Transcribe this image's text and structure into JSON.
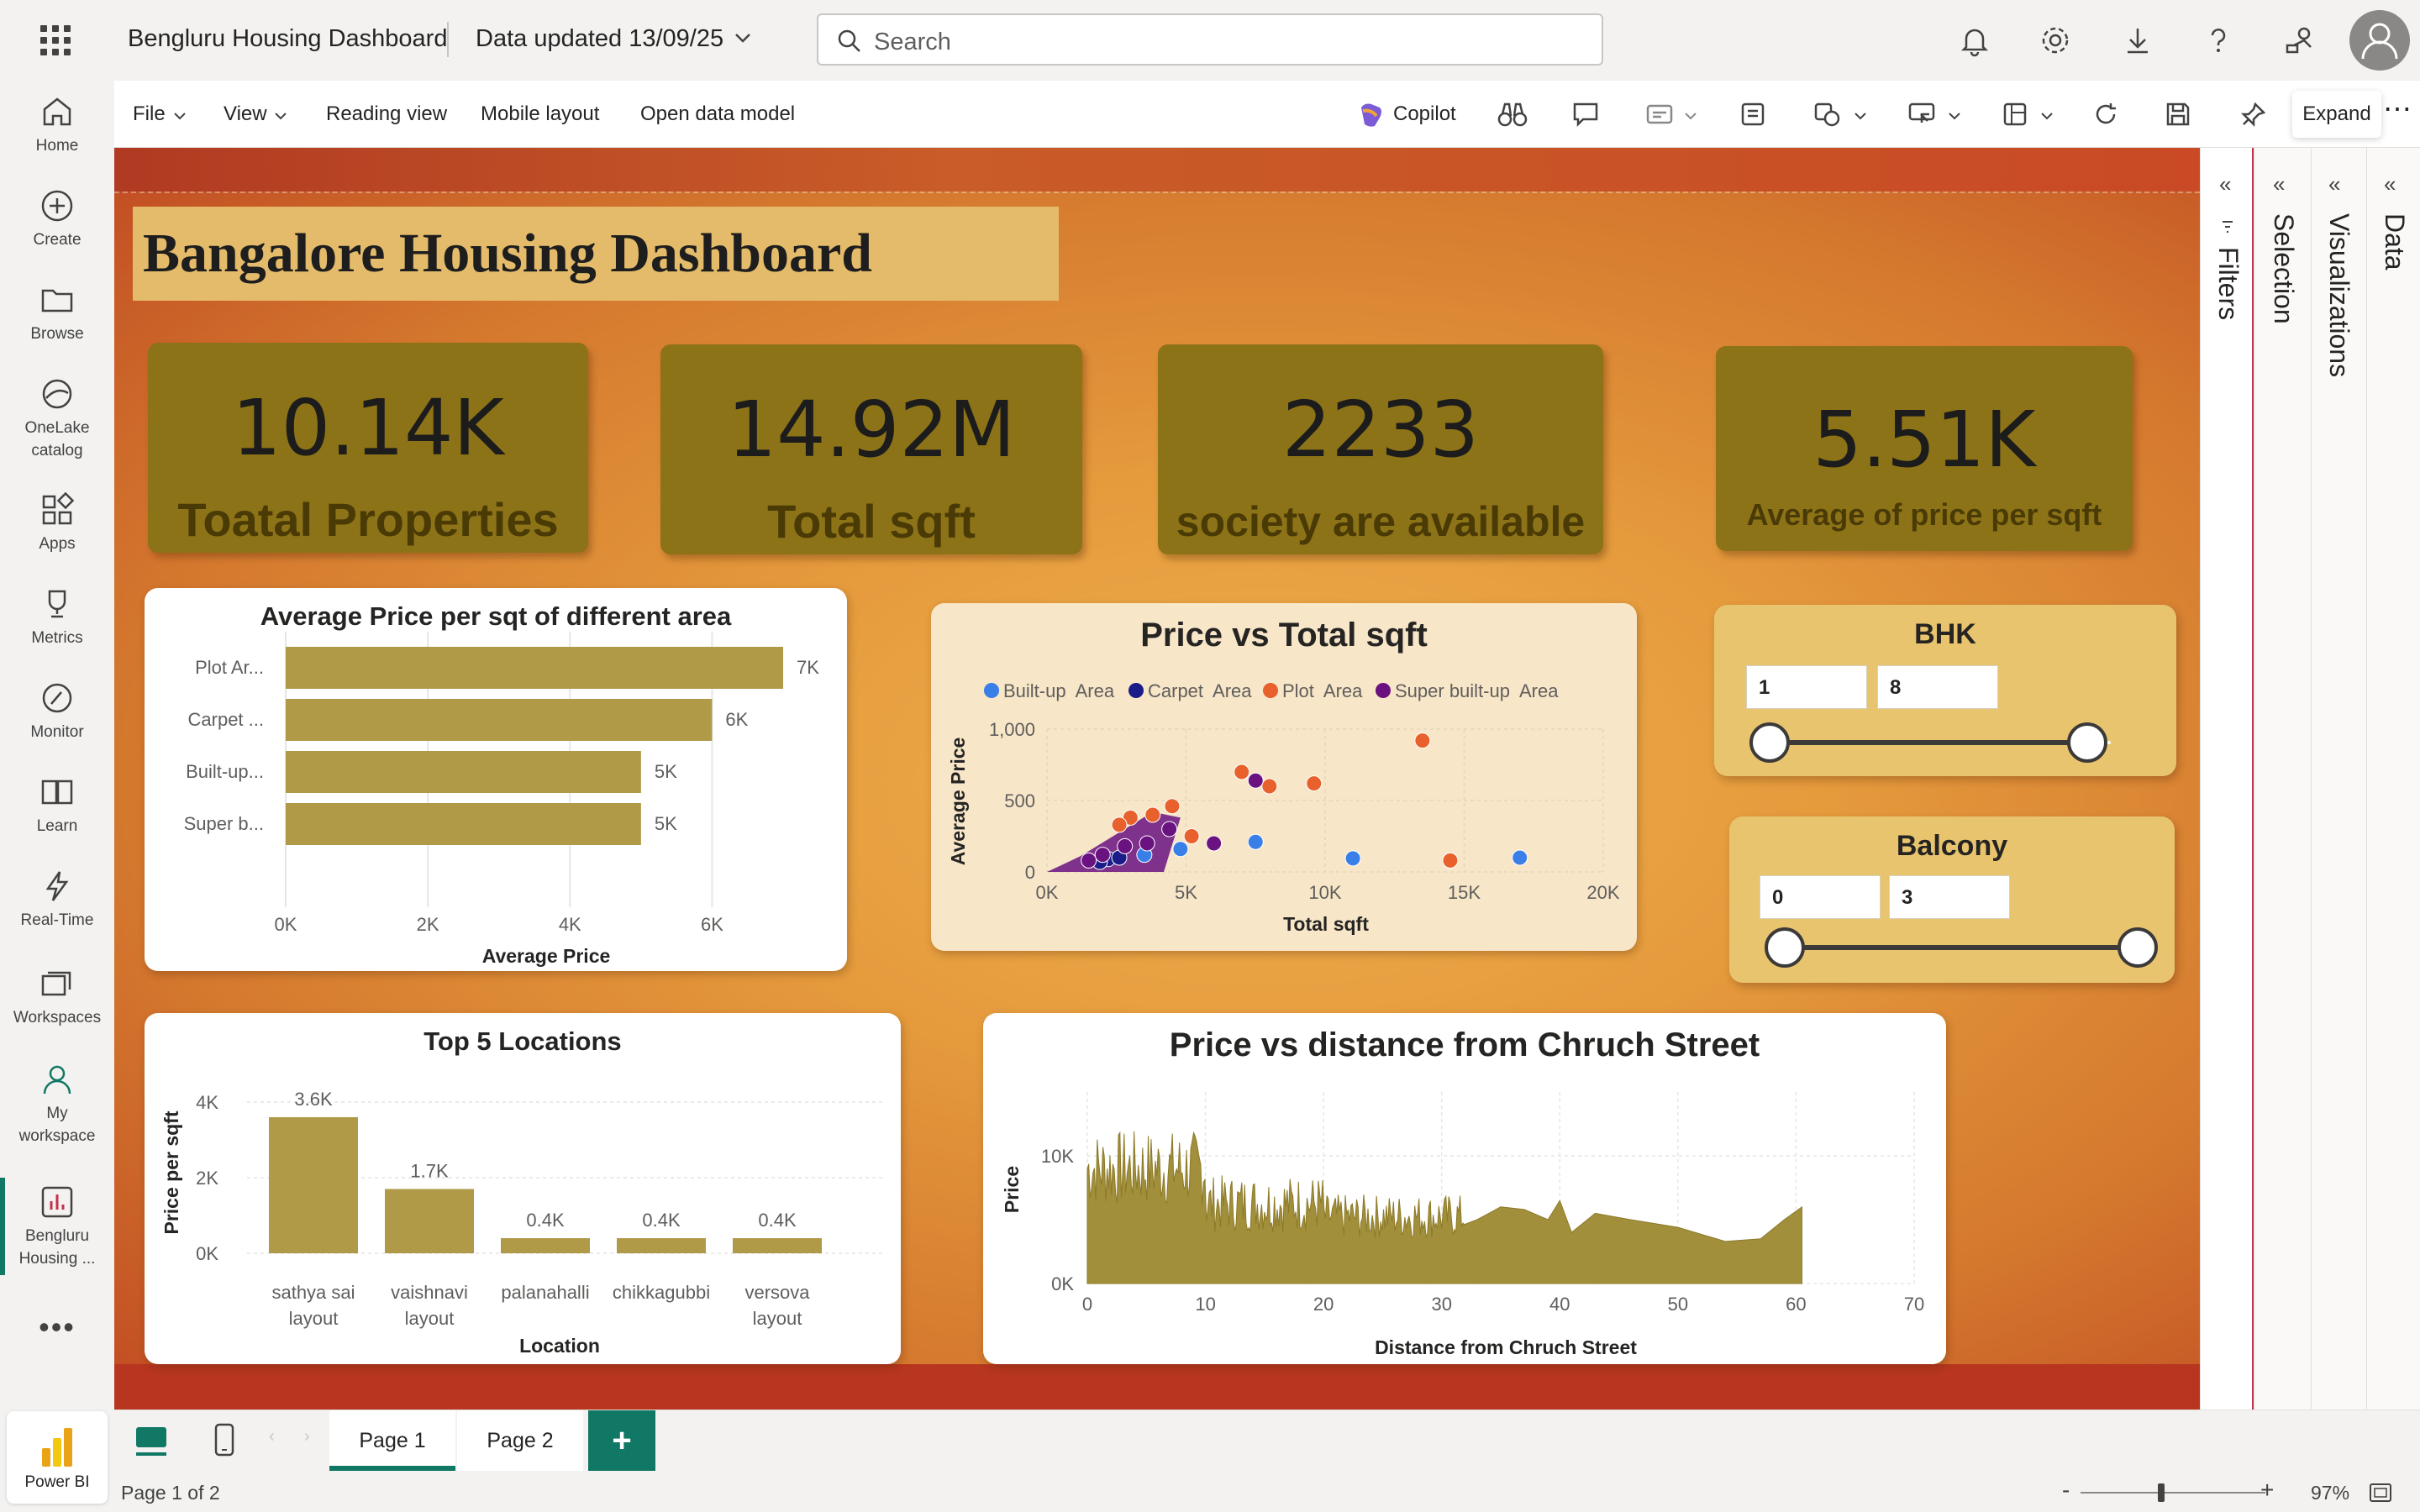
{
  "header": {
    "app_title": "Bengluru Housing Dashboard",
    "updated": "Data updated 13/09/25",
    "search_placeholder": "Search"
  },
  "rail": [
    {
      "label": "Home",
      "icon": "home-icon"
    },
    {
      "label": "Create",
      "icon": "plus-circle-icon"
    },
    {
      "label": "Browse",
      "icon": "folder-icon"
    },
    {
      "label": "OneLake catalog",
      "icon": "onelake-icon"
    },
    {
      "label": "Apps",
      "icon": "apps-icon"
    },
    {
      "label": "Metrics",
      "icon": "trophy-icon"
    },
    {
      "label": "Monitor",
      "icon": "monitor-icon"
    },
    {
      "label": "Learn",
      "icon": "book-icon"
    },
    {
      "label": "Real-Time",
      "icon": "lightning-icon"
    },
    {
      "label": "Workspaces",
      "icon": "workspaces-icon"
    },
    {
      "label": "My workspace",
      "icon": "person-icon"
    },
    {
      "label": "Bengluru Housing ...",
      "icon": "report-icon"
    }
  ],
  "power_bi_label": "Power BI",
  "toolbar": {
    "file": "File",
    "view": "View",
    "reading_view": "Reading view",
    "mobile_layout": "Mobile layout",
    "open_data_model": "Open data model",
    "copilot": "Copilot",
    "tooltip": "Expand"
  },
  "panes": {
    "filters": "Filters",
    "selection": "Selection",
    "visualizations": "Visualizations",
    "data": "Data"
  },
  "dashboard": {
    "title": "Bangalore Housing Dashboard",
    "kpis": [
      {
        "value": "10.14K",
        "label": "Toatal Properties"
      },
      {
        "value": "14.92M",
        "label": "Total sqft"
      },
      {
        "value": "2233",
        "label": "society are available"
      },
      {
        "value": "5.51K",
        "label": "Average of price per sqft"
      }
    ]
  },
  "slicers": {
    "bhk": {
      "title": "BHK",
      "min": "1",
      "max": "8"
    },
    "balcony": {
      "title": "Balcony",
      "min": "0",
      "max": "3"
    }
  },
  "chart_data": [
    {
      "type": "bar",
      "orientation": "horizontal",
      "title": "Average Price per sqt of different area",
      "xlabel": "Average Price",
      "ylabel": "",
      "categories": [
        "Plot Ar...",
        "Carpet ...",
        "Built-up...",
        "Super b..."
      ],
      "values": [
        7000,
        6000,
        5000,
        5000
      ],
      "data_labels": [
        "7K",
        "6K",
        "5K",
        "5K"
      ],
      "xlim": [
        0,
        7000
      ],
      "x_ticks": [
        "0K",
        "2K",
        "4K",
        "6K"
      ],
      "color": "#b09a48",
      "grid": true
    },
    {
      "type": "scatter",
      "title": "Price vs Total sqft",
      "xlabel": "Total sqft",
      "ylabel": "Average Price",
      "legend_position": "top",
      "xlim": [
        0,
        20000
      ],
      "ylim": [
        0,
        1000
      ],
      "x_ticks": [
        "0K",
        "5K",
        "10K",
        "15K",
        "20K"
      ],
      "y_ticks": [
        "0",
        "500",
        "1,000"
      ],
      "series": [
        {
          "name": "Built-up  Area",
          "color": "#3a7ee8",
          "points": [
            [
              7500,
              210
            ],
            [
              11000,
              95
            ],
            [
              17000,
              100
            ],
            [
              4800,
              160
            ],
            [
              3500,
              120
            ]
          ]
        },
        {
          "name": "Carpet  Area",
          "color": "#1b1b8a",
          "points": [
            [
              2200,
              90
            ],
            [
              1900,
              70
            ],
            [
              2600,
              100
            ]
          ]
        },
        {
          "name": "Plot  Area",
          "color": "#e8602c",
          "points": [
            [
              13500,
              920
            ],
            [
              7000,
              700
            ],
            [
              8000,
              600
            ],
            [
              9600,
              620
            ],
            [
              14500,
              80
            ],
            [
              3800,
              400
            ],
            [
              5200,
              250
            ],
            [
              4500,
              460
            ],
            [
              3000,
              380
            ],
            [
              2600,
              330
            ]
          ]
        },
        {
          "name": "Super built-up  Area",
          "color": "#6a1280",
          "points": [
            [
              7500,
              640
            ],
            [
              6000,
              200
            ],
            [
              4400,
              300
            ],
            [
              3600,
              200
            ],
            [
              2800,
              180
            ],
            [
              2000,
              120
            ],
            [
              1500,
              80
            ]
          ]
        }
      ]
    },
    {
      "type": "bar",
      "title": "Top 5 Locations",
      "xlabel": "Location",
      "ylabel": "Price per sqft",
      "categories": [
        "sathya sai layout",
        "vaishnavi layout",
        "palanahalli",
        "chikkagubbi",
        "versova layout"
      ],
      "values": [
        3600,
        1700,
        400,
        400,
        400
      ],
      "data_labels": [
        "3.6K",
        "1.7K",
        "0.4K",
        "0.4K",
        "0.4K"
      ],
      "ylim": [
        0,
        4000
      ],
      "y_ticks": [
        "0K",
        "2K",
        "4K"
      ],
      "color": "#b09a48",
      "grid": true
    },
    {
      "type": "area",
      "title": "Price vs distance from Chruch Street",
      "xlabel": "Distance from Chruch Street",
      "ylabel": "Price",
      "xlim": [
        0,
        70
      ],
      "ylim": [
        0,
        15000
      ],
      "x_ticks": [
        "0",
        "10",
        "20",
        "30",
        "40",
        "50",
        "60",
        "70"
      ],
      "y_ticks": [
        "0K",
        "10K"
      ],
      "color": "#a18f3c",
      "grid": true
    }
  ],
  "pages": {
    "tabs": [
      "Page 1",
      "Page 2"
    ],
    "active": "Page 1",
    "status": "Page 1 of 2",
    "zoom": "97%"
  }
}
